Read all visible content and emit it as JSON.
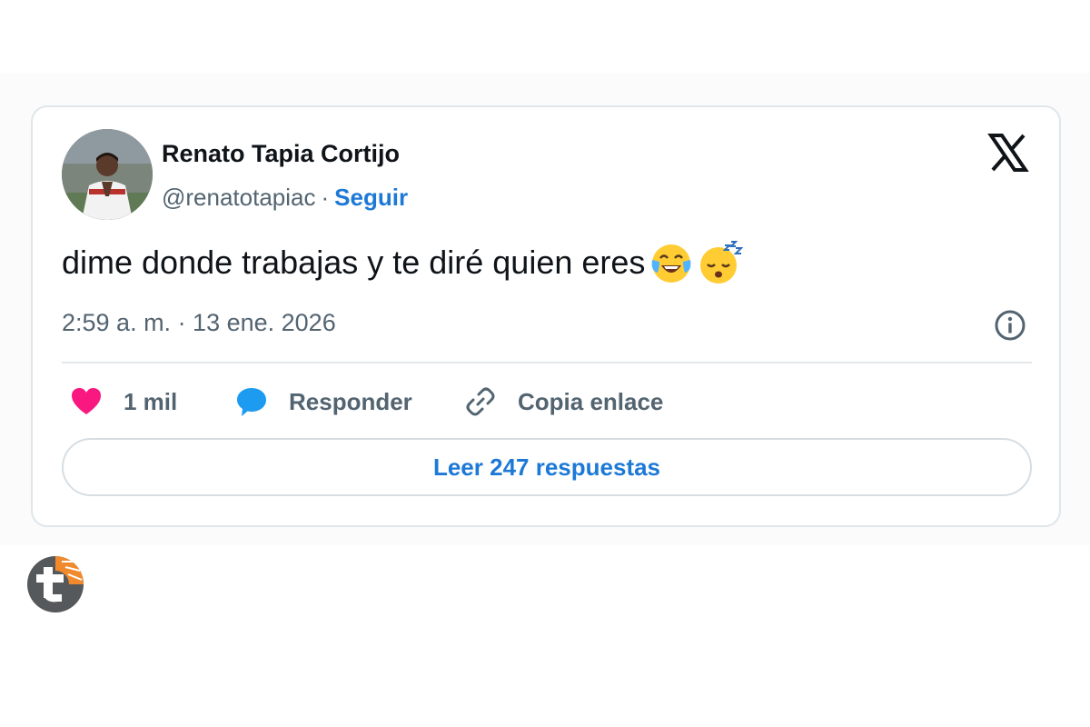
{
  "tweet": {
    "author_name": "Renato Tapia Cortijo",
    "handle": "@renatotapiac",
    "separator": "·",
    "follow_label": "Seguir",
    "text": "dime donde trabajas y te diré quien eres",
    "emojis": [
      "face-with-tears-of-joy",
      "sleeping-face"
    ],
    "timestamp": "2:59 a. m. · 13 ene. 2026",
    "actions": {
      "like_count": "1 mil",
      "reply_label": "Responder",
      "copy_label": "Copia enlace"
    },
    "read_replies_label": "Leer 247 respuestas"
  },
  "icons": {
    "platform_logo": "x-logo",
    "info": "info-icon",
    "like": "heart-icon",
    "reply": "speech-bubble-icon",
    "copy": "link-icon",
    "watermark": "site-logo"
  },
  "colors": {
    "like": "#f91880",
    "reply": "#1d9bf0",
    "follow": "#1d79d6",
    "text": "#0f1419",
    "muted": "#536471"
  }
}
